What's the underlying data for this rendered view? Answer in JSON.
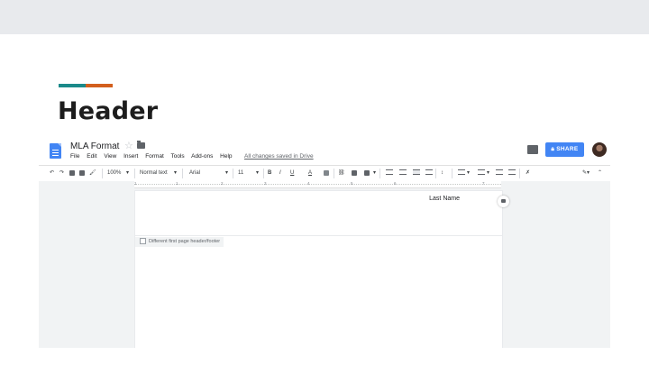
{
  "slide": {
    "title": "Header",
    "accent_colors": [
      "#1b8a8a",
      "#d35f1d"
    ]
  },
  "app": {
    "doc_title": "MLA Format",
    "menu": [
      "File",
      "Edit",
      "View",
      "Insert",
      "Format",
      "Tools",
      "Add-ons",
      "Help"
    ],
    "saved_status": "All changes saved in Drive",
    "share_label": "SHARE",
    "share_color": "#4285f4",
    "icons": {
      "logo": "docs-logo",
      "star": "star-icon",
      "folder": "folder-icon",
      "comments": "comments-icon",
      "avatar": "user-avatar"
    }
  },
  "toolbar": {
    "zoom": "100%",
    "style": "Normal text",
    "font": "Arial",
    "size": "11",
    "bold": "B",
    "italic": "I",
    "underline": "U",
    "text_color": "A"
  },
  "ruler": {
    "marks": [
      "1",
      "1",
      "2",
      "3",
      "4",
      "5",
      "6",
      "7"
    ]
  },
  "document": {
    "header_text": "Last Name",
    "header_option": "Different first page header/footer"
  }
}
